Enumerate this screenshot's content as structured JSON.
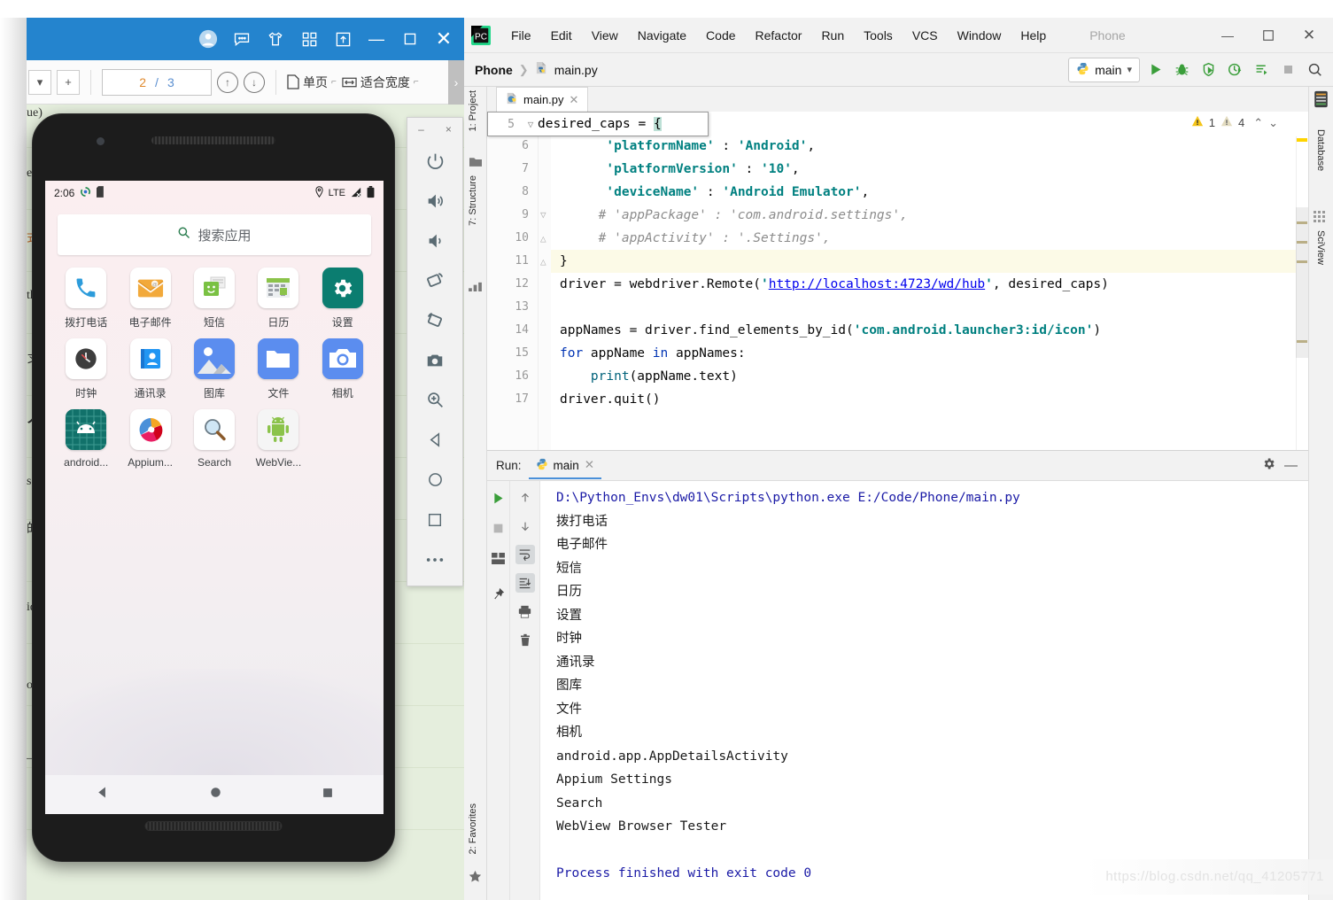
{
  "pdf_window": {
    "titlebar_icons": [
      "avatar-icon",
      "comment-icon",
      "shirt-icon",
      "grid-icon",
      "share-icon",
      "minimize-icon",
      "maximize-icon",
      "close-icon"
    ],
    "toolbar": {
      "zoom_dropdown": "▾",
      "zoom_plus": "+",
      "current_page": "2",
      "page_separator": "/",
      "total_pages": "3",
      "prev_page_icon": "arrow-up-circle-icon",
      "next_page_icon": "arrow-down-circle-icon",
      "single_page_label": "单页",
      "fit_width_label": "适合宽度",
      "overflow_label": "›"
    },
    "document_fragments": [
      "ue)",
      "e(",
      "式",
      "th",
      "习",
      "人",
      "s ",
      "的",
      "id",
      "oy",
      "_xpa"
    ]
  },
  "emulator": {
    "window_controls": {
      "minimize": "–",
      "close": "×"
    },
    "buttons": [
      "power-icon",
      "volume-up-icon",
      "volume-down-icon",
      "rotate-left-icon",
      "rotate-right-icon",
      "screenshot-camera-icon",
      "zoom-icon",
      "back-triangle-icon",
      "home-circle-icon",
      "overview-square-icon",
      "more-ellipsis-icon"
    ],
    "phone": {
      "status_bar": {
        "time": "2:06",
        "left_icons": [
          "sync-icon",
          "sdcard-icon"
        ],
        "right_icons": [
          "location-icon",
          "signal-icon",
          "battery-icon"
        ],
        "network": "LTE"
      },
      "search": {
        "label": "搜索应用",
        "icon": "search-icon"
      },
      "apps": [
        {
          "label": "拨打电话",
          "icon": "phone-dialer-icon",
          "bg": "#ffffff"
        },
        {
          "label": "电子邮件",
          "icon": "email-icon",
          "bg": "#ffffff"
        },
        {
          "label": "短信",
          "icon": "sms-messaging-icon",
          "bg": "#ffffff"
        },
        {
          "label": "日历",
          "icon": "calendar-icon",
          "bg": "#ffffff"
        },
        {
          "label": "设置",
          "icon": "settings-gear-icon",
          "bg": "#0b7d70"
        },
        {
          "label": "时钟",
          "icon": "clock-icon",
          "bg": "#ffffff"
        },
        {
          "label": "通讯录",
          "icon": "contacts-icon",
          "bg": "#ffffff"
        },
        {
          "label": "图库",
          "icon": "gallery-photos-icon",
          "bg": "#5b8def"
        },
        {
          "label": "文件",
          "icon": "files-folder-icon",
          "bg": "#5b8def"
        },
        {
          "label": "相机",
          "icon": "camera-icon",
          "bg": "#5b8def"
        },
        {
          "label": "android...",
          "icon": "android-app-details-icon",
          "bg": "#0e6f67"
        },
        {
          "label": "Appium...",
          "icon": "appium-icon",
          "bg": "#ffffff"
        },
        {
          "label": "Search",
          "icon": "search-magnifier-icon",
          "bg": "#ffffff"
        },
        {
          "label": "WebVie...",
          "icon": "webview-android-icon",
          "bg": "#f5f5f5"
        }
      ],
      "nav_bar": [
        "back-icon",
        "home-icon",
        "recents-icon"
      ]
    }
  },
  "ide": {
    "menu": [
      {
        "label": "File",
        "accel": "F"
      },
      {
        "label": "Edit",
        "accel": "E"
      },
      {
        "label": "View",
        "accel": "V"
      },
      {
        "label": "Navigate",
        "accel": "N"
      },
      {
        "label": "Code",
        "accel": "C"
      },
      {
        "label": "Refactor",
        "accel": "R"
      },
      {
        "label": "Run",
        "accel": "R"
      },
      {
        "label": "Tools",
        "accel": "T"
      },
      {
        "label": "VCS",
        "accel": "S"
      },
      {
        "label": "Window",
        "accel": "W"
      },
      {
        "label": "Help",
        "accel": "H"
      }
    ],
    "project_title": "Phone",
    "window_controls": {
      "minimize": "—",
      "maximize": "▭",
      "close": "✕"
    },
    "breadcrumb": {
      "project": "Phone",
      "separator": "❯",
      "file": "main.py"
    },
    "run_config": {
      "name": "main",
      "dropdown": "▾"
    },
    "toolbar_icons": [
      "run-icon",
      "debug-icon",
      "coverage-icon",
      "profile-icon",
      "run-with-console-icon",
      "stop-icon",
      "search-everywhere-icon"
    ],
    "left_strip": [
      "1: Project",
      "7: Structure",
      "2: Favorites"
    ],
    "right_strip": [
      "Database",
      "SciView"
    ],
    "editor": {
      "tab": {
        "label": "main.py",
        "close": "✕"
      },
      "inspection": {
        "warnings": "1",
        "weak_warnings": "4",
        "up": "⌃",
        "down": "⌄"
      },
      "lines": [
        {
          "num": "5",
          "text": "desired_caps = {"
        },
        {
          "num": "6",
          "text": "    'platformName' : 'Android',"
        },
        {
          "num": "7",
          "text": "    'platformVersion' : '10',"
        },
        {
          "num": "8",
          "text": "    'deviceName' : 'Android Emulator',"
        },
        {
          "num": "9",
          "text": "   # 'appPackage' : 'com.android.settings',"
        },
        {
          "num": "10",
          "text": "   # 'appActivity' : '.Settings',"
        },
        {
          "num": "11",
          "text": "}"
        },
        {
          "num": "12",
          "text": "driver = webdriver.Remote('http://localhost:4723/wd/hub', desired_caps)"
        },
        {
          "num": "13",
          "text": ""
        },
        {
          "num": "14",
          "text": "appNames = driver.find_elements_by_id('com.android.launcher3:id/icon')"
        },
        {
          "num": "15",
          "text": "for appName in appNames:"
        },
        {
          "num": "16",
          "text": "    print(appName.text)"
        },
        {
          "num": "17",
          "text": "driver.quit()"
        }
      ]
    },
    "run_panel": {
      "label": "Run:",
      "tab": {
        "label": "main",
        "close": "✕"
      },
      "header_icons": [
        "settings-gear-icon",
        "hide-minimize-icon"
      ],
      "side_icons": [
        "rerun-icon",
        "stop-icon",
        "layout-icon",
        "pin-icon"
      ],
      "side_icons2": [
        "up-arrow-icon",
        "down-arrow-icon",
        "soft-wrap-icon",
        "scroll-to-end-icon",
        "print-icon",
        "clear-all-icon"
      ],
      "console": [
        {
          "text": "D:\\Python_Envs\\dw01\\Scripts\\python.exe E:/Code/Phone/main.py",
          "style": "cmd"
        },
        {
          "text": "拨打电话",
          "style": "out"
        },
        {
          "text": "电子邮件",
          "style": "out"
        },
        {
          "text": "短信",
          "style": "out"
        },
        {
          "text": "日历",
          "style": "out"
        },
        {
          "text": "设置",
          "style": "out"
        },
        {
          "text": "时钟",
          "style": "out"
        },
        {
          "text": "通讯录",
          "style": "out"
        },
        {
          "text": "图库",
          "style": "out"
        },
        {
          "text": "文件",
          "style": "out"
        },
        {
          "text": "相机",
          "style": "out"
        },
        {
          "text": "android.app.AppDetailsActivity",
          "style": "out"
        },
        {
          "text": "Appium Settings",
          "style": "out"
        },
        {
          "text": "Search",
          "style": "out"
        },
        {
          "text": "WebView Browser Tester",
          "style": "out"
        },
        {
          "text": "",
          "style": "out"
        },
        {
          "text": "Process finished with exit code 0",
          "style": "done"
        }
      ]
    }
  },
  "watermark": "https://blog.csdn.net/qq_41205771",
  "colors": {
    "pdf_titlebar": "#2484ce",
    "pdf_body": "#e5eedd",
    "ide_bg": "#f2f2f2",
    "accent_green": "#3a9e3a",
    "console_blue": "#1a1aa6",
    "string_green": "#008080",
    "keyword_blue": "#0033b3",
    "settings_teal": "#0b7d70"
  }
}
